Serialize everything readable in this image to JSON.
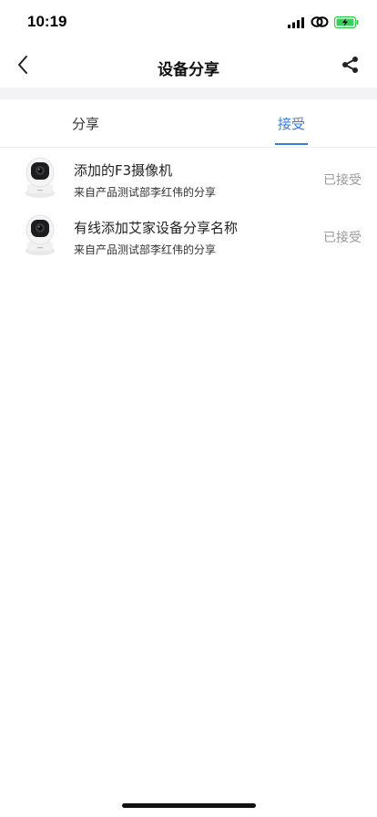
{
  "status_bar": {
    "time": "10:19"
  },
  "header": {
    "title": "设备分享",
    "back_icon": "chevron-left-icon",
    "share_icon": "share-icon"
  },
  "tabs": [
    {
      "label": "分享",
      "active": false
    },
    {
      "label": "接受",
      "active": true
    }
  ],
  "accent_color": "#3d7bd8",
  "devices": [
    {
      "name": "添加的F3摄像机",
      "from": "来自产品测试部李红伟的分享",
      "status": "已接受"
    },
    {
      "name": "有线添加艾家设备分享名称",
      "from": "来自产品测试部李红伟的分享",
      "status": "已接受"
    }
  ]
}
